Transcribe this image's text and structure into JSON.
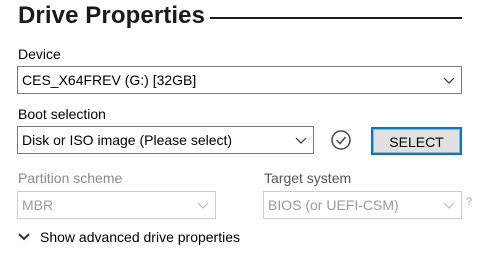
{
  "section": {
    "title": "Drive Properties"
  },
  "device": {
    "label": "Device",
    "value": "CES_X64FREV (G:) [32GB]"
  },
  "boot_selection": {
    "label": "Boot selection",
    "value": "Disk or ISO image (Please select)",
    "select_button": "SELECT"
  },
  "partition_scheme": {
    "label": "Partition scheme",
    "value": "MBR"
  },
  "target_system": {
    "label": "Target system",
    "value": "BIOS (or UEFI-CSM)",
    "help": "?"
  },
  "advanced": {
    "label": "Show advanced drive properties"
  },
  "colors": {
    "accent": "#0078d7",
    "disabled_text": "#8a8a8a",
    "border": "#7a7a7a"
  },
  "icons": {
    "check": "check-circle-icon",
    "chevron": "chevron-down-icon"
  }
}
